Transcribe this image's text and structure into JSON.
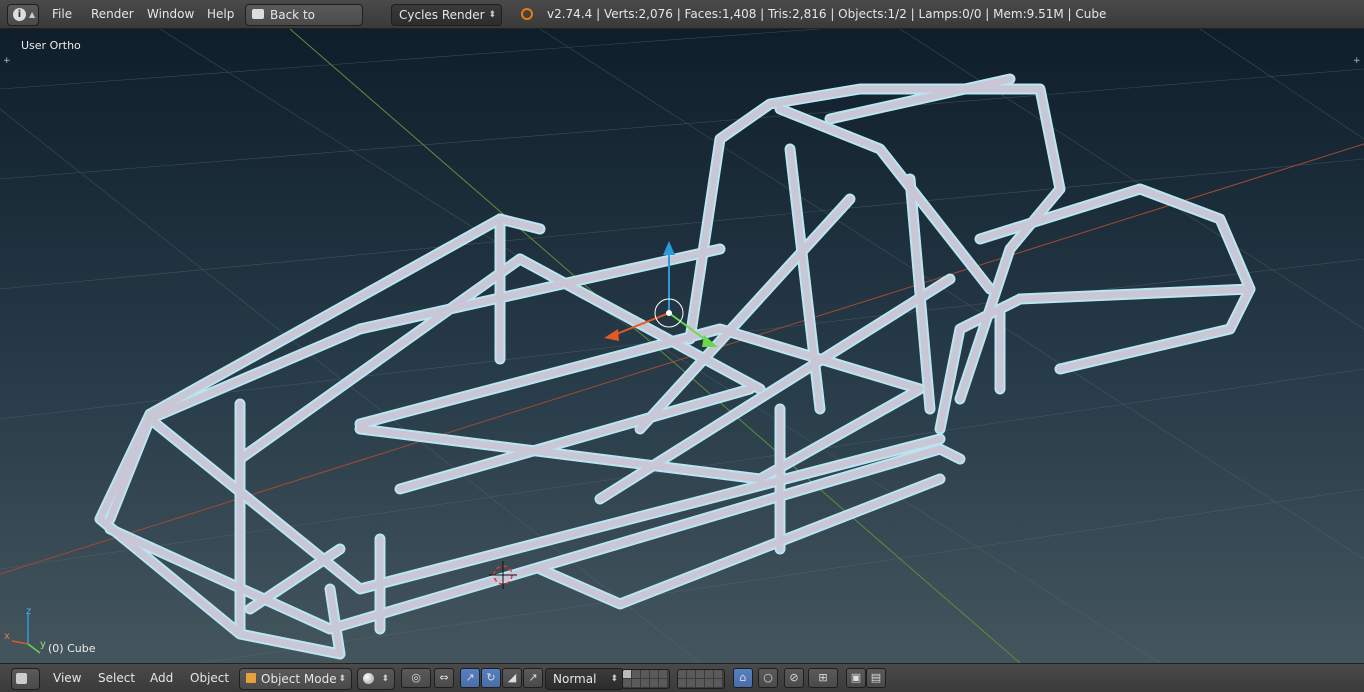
{
  "topbar": {
    "menus": [
      "File",
      "Render",
      "Window",
      "Help"
    ],
    "back_button": "Back to Previous",
    "render_engine": "Cycles Render",
    "stats": "v2.74.4 | Verts:2,076 | Faces:1,408 | Tris:2,816 | Objects:1/2 | Lamps:0/0 | Mem:9.51M | Cube"
  },
  "viewport": {
    "view_label": "User Ortho",
    "object_label": "(0) Cube",
    "axis_labels": {
      "x": "x",
      "y": "y",
      "z": "z"
    }
  },
  "bottombar": {
    "menus": [
      "View",
      "Select",
      "Add",
      "Object"
    ],
    "mode": "Object Mode",
    "orientation": "Normal"
  },
  "colors": {
    "viewport_top": "#0f1e2b",
    "viewport_bottom": "#44555d",
    "frame": "#c9c6d6",
    "selection_outline": "#9fd4e6",
    "manip_z": "#2a9ad8",
    "manip_y": "#6ad84a",
    "manip_x": "#e05a28"
  },
  "icons": [
    "info-icon",
    "blender-logo-icon",
    "back-arrow-icon",
    "view3d-icon",
    "object-mode-cube-icon",
    "shading-sphere-icon",
    "pivot-icon",
    "manipulator-icon",
    "translate-icon",
    "rotate-icon",
    "scale-icon",
    "layers-icon",
    "lock-icon",
    "proportional-icon",
    "snap-icon",
    "render-icon",
    "anim-icon"
  ]
}
